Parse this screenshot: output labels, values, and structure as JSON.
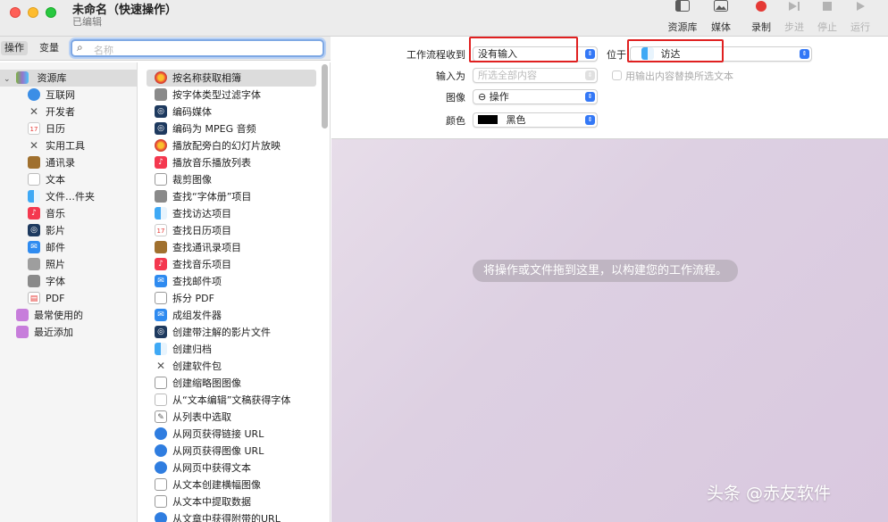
{
  "window": {
    "title": "未命名（快速操作）",
    "subtitle": "已编辑"
  },
  "toolbar": {
    "library": "资源库",
    "media": "媒体",
    "record": "录制",
    "step": "步进",
    "stop": "停止",
    "run": "运行"
  },
  "left_tabs": {
    "actions": "操作",
    "variables": "变量",
    "search_placeholder": "名称"
  },
  "library": {
    "root": "资源库",
    "items": [
      "互联网",
      "开发者",
      "日历",
      "实用工具",
      "通讯录",
      "文本",
      "文件…件夹",
      "音乐",
      "影片",
      "邮件",
      "照片",
      "字体",
      "PDF"
    ],
    "extras": [
      "最常使用的",
      "最近添加"
    ]
  },
  "actions": [
    "按名称获取相簿",
    "按字体类型过滤字体",
    "编码媒体",
    "编码为 MPEG 音频",
    "播放配旁白的幻灯片放映",
    "播放音乐播放列表",
    "裁剪图像",
    "查找“字体册”项目",
    "查找访达项目",
    "查找日历项目",
    "查找通讯录项目",
    "查找音乐项目",
    "查找邮件项",
    "拆分 PDF",
    "成组发件器",
    "创建带注解的影片文件",
    "创建归档",
    "创建软件包",
    "创建缩略图图像",
    "从“文本编辑”文稿获得字体",
    "从列表中选取",
    "从网页获得链接 URL",
    "从网页获得图像 URL",
    "从网页中获得文本",
    "从文本创建横幅图像",
    "从文本中提取数据",
    "从文章中获得附带的URL"
  ],
  "workflow": {
    "receives_label": "工作流程收到",
    "receives_value": "没有输入",
    "location_label": "位于",
    "location_value": "访达",
    "input_label": "输入为",
    "input_value": "所选全部内容",
    "replace_label": "用输出内容替换所选文本",
    "image_label": "图像",
    "image_value": "⊖ 操作",
    "color_label": "颜色",
    "color_value": "黑色",
    "drop_hint": "将操作或文件拖到这里，以构建您的工作流程。"
  },
  "watermark": "头条 @赤友软件",
  "colors": {
    "accent": "#3478f6",
    "highlight_box": "#e02020",
    "record": "#e53935"
  }
}
